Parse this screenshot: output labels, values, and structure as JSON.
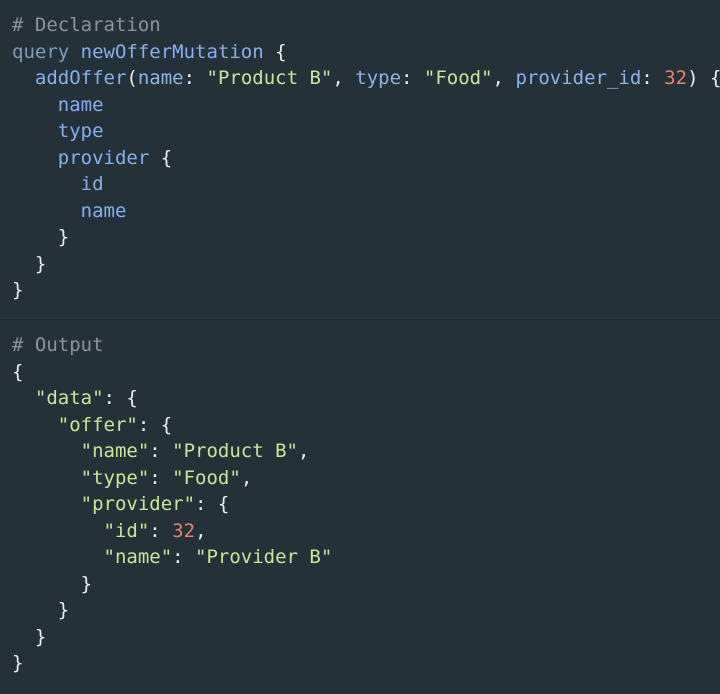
{
  "theme": {
    "background": "#243138",
    "divider": "#1b262c",
    "comment": "#8c9499",
    "keyword": "#7d9dbd",
    "identifier": "#86b0ee",
    "argument": "#8ab6ec",
    "string": "#c8e79a",
    "number": "#ee7f74",
    "punctuation": "#e9f0f4",
    "field": "#82b2f0"
  },
  "declaration": {
    "comment": "# Declaration",
    "lines": [
      {
        "indent": 0,
        "tokens": [
          {
            "t": "query",
            "c": "kw"
          },
          {
            "t": " ",
            "c": "pn"
          },
          {
            "t": "newOfferMutation",
            "c": "fn"
          },
          {
            "t": " {",
            "c": "pn"
          }
        ]
      },
      {
        "indent": 1,
        "tokens": [
          {
            "t": "addOffer",
            "c": "fn"
          },
          {
            "t": "(",
            "c": "pn"
          },
          {
            "t": "name",
            "c": "arg"
          },
          {
            "t": ": ",
            "c": "pn"
          },
          {
            "t": "\"Product B\"",
            "c": "str"
          },
          {
            "t": ", ",
            "c": "pn"
          },
          {
            "t": "type",
            "c": "arg"
          },
          {
            "t": ": ",
            "c": "pn"
          },
          {
            "t": "\"Food\"",
            "c": "str"
          },
          {
            "t": ", ",
            "c": "pn"
          },
          {
            "t": "provider_id",
            "c": "arg"
          },
          {
            "t": ": ",
            "c": "pn"
          },
          {
            "t": "32",
            "c": "num"
          },
          {
            "t": ") {",
            "c": "pn"
          }
        ]
      },
      {
        "indent": 2,
        "tokens": [
          {
            "t": "name",
            "c": "fld"
          }
        ]
      },
      {
        "indent": 2,
        "tokens": [
          {
            "t": "type",
            "c": "fld"
          }
        ]
      },
      {
        "indent": 2,
        "tokens": [
          {
            "t": "provider",
            "c": "fld"
          },
          {
            "t": " {",
            "c": "pn"
          }
        ]
      },
      {
        "indent": 3,
        "tokens": [
          {
            "t": "id",
            "c": "fld"
          }
        ]
      },
      {
        "indent": 3,
        "tokens": [
          {
            "t": "name",
            "c": "fld"
          }
        ]
      },
      {
        "indent": 2,
        "tokens": [
          {
            "t": "}",
            "c": "pn"
          }
        ]
      },
      {
        "indent": 1,
        "tokens": [
          {
            "t": "}",
            "c": "pn"
          }
        ]
      },
      {
        "indent": 0,
        "tokens": [
          {
            "t": "}",
            "c": "pn"
          }
        ]
      }
    ]
  },
  "output": {
    "comment": "# Output",
    "lines": [
      {
        "indent": 0,
        "tokens": [
          {
            "t": "{",
            "c": "pn"
          }
        ]
      },
      {
        "indent": 1,
        "tokens": [
          {
            "t": "\"data\"",
            "c": "key"
          },
          {
            "t": ": {",
            "c": "pn"
          }
        ]
      },
      {
        "indent": 2,
        "tokens": [
          {
            "t": "\"offer\"",
            "c": "key"
          },
          {
            "t": ": {",
            "c": "pn"
          }
        ]
      },
      {
        "indent": 3,
        "tokens": [
          {
            "t": "\"name\"",
            "c": "key"
          },
          {
            "t": ": ",
            "c": "pn"
          },
          {
            "t": "\"Product B\"",
            "c": "str"
          },
          {
            "t": ",",
            "c": "pn"
          }
        ]
      },
      {
        "indent": 3,
        "tokens": [
          {
            "t": "\"type\"",
            "c": "key"
          },
          {
            "t": ": ",
            "c": "pn"
          },
          {
            "t": "\"Food\"",
            "c": "str"
          },
          {
            "t": ",",
            "c": "pn"
          }
        ]
      },
      {
        "indent": 3,
        "tokens": [
          {
            "t": "\"provider\"",
            "c": "key"
          },
          {
            "t": ": {",
            "c": "pn"
          }
        ]
      },
      {
        "indent": 4,
        "tokens": [
          {
            "t": "\"id\"",
            "c": "key"
          },
          {
            "t": ": ",
            "c": "pn"
          },
          {
            "t": "32",
            "c": "num"
          },
          {
            "t": ",",
            "c": "pn"
          }
        ]
      },
      {
        "indent": 4,
        "tokens": [
          {
            "t": "\"name\"",
            "c": "key"
          },
          {
            "t": ": ",
            "c": "pn"
          },
          {
            "t": "\"Provider B\"",
            "c": "str"
          }
        ]
      },
      {
        "indent": 3,
        "tokens": [
          {
            "t": "}",
            "c": "pn"
          }
        ]
      },
      {
        "indent": 2,
        "tokens": [
          {
            "t": "}",
            "c": "pn"
          }
        ]
      },
      {
        "indent": 1,
        "tokens": [
          {
            "t": "}",
            "c": "pn"
          }
        ]
      },
      {
        "indent": 0,
        "tokens": [
          {
            "t": "}",
            "c": "pn"
          }
        ]
      }
    ]
  }
}
